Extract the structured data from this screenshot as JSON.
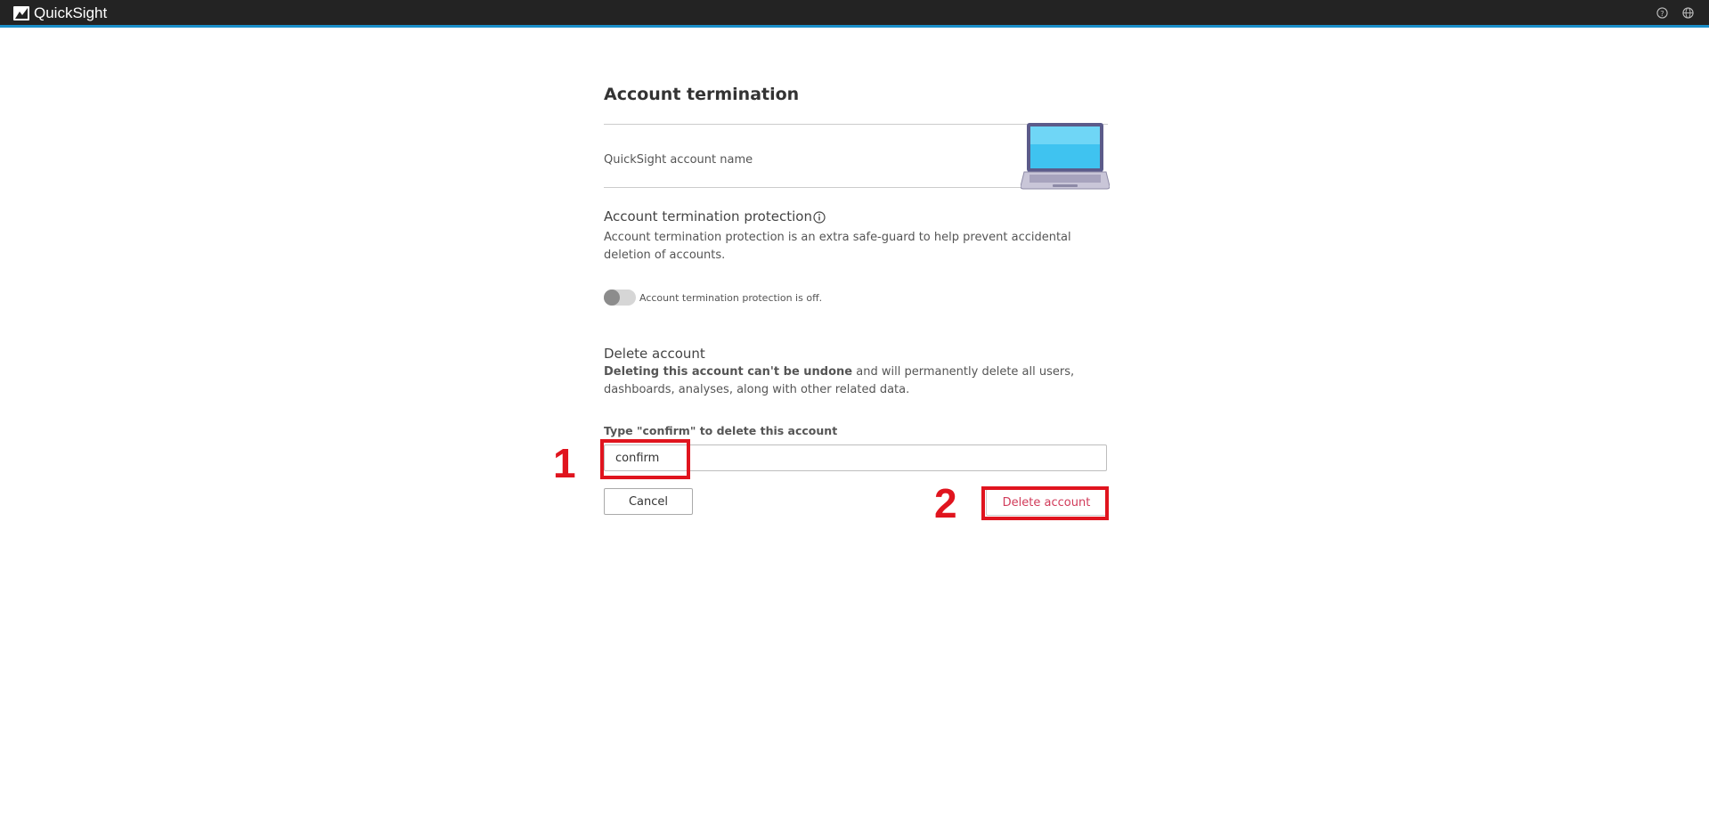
{
  "header": {
    "brand": "QuickSight",
    "help_icon": "help-circle-icon",
    "globe_icon": "globe-icon",
    "accent_color": "#1a8ec9"
  },
  "page": {
    "title": "Account termination",
    "account_name_label": "QuickSight account name"
  },
  "protection": {
    "heading": "Account termination protection",
    "description": "Account termination protection is an extra safe-guard to help prevent accidental deletion of accounts.",
    "toggle_state": "off",
    "toggle_label": "Account termination protection is off."
  },
  "delete": {
    "heading": "Delete account",
    "description_bold": "Deleting this account can't be undone",
    "description_rest": " and will permanently delete all users, dashboards, analyses, along with other related data.",
    "confirm_label": "Type \"confirm\" to delete this account",
    "confirm_value": "confirm",
    "cancel_label": "Cancel",
    "delete_label": "Delete account",
    "delete_color": "#d13b5a"
  },
  "annotations": {
    "step_1": "1",
    "step_2": "2",
    "color": "#e0141e"
  }
}
